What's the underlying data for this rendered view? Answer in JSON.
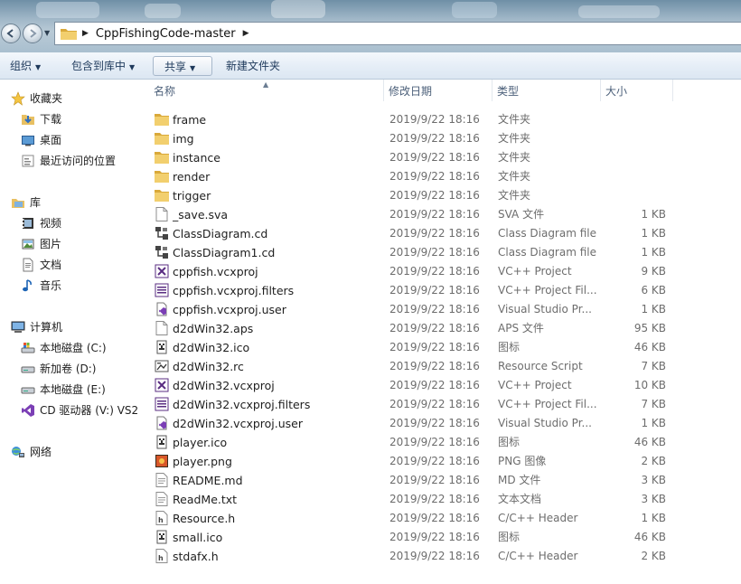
{
  "address": {
    "segments": [
      "CppFishingCode-master"
    ]
  },
  "toolbar": {
    "organize": "组织",
    "include_in_library": "包含到库中",
    "share": "共享",
    "new_folder": "新建文件夹"
  },
  "nav": {
    "favorites": {
      "label": "收藏夹",
      "items": [
        "下载",
        "桌面",
        "最近访问的位置"
      ]
    },
    "libraries": {
      "label": "库",
      "items": [
        "视频",
        "图片",
        "文档",
        "音乐"
      ]
    },
    "computer": {
      "label": "计算机",
      "items": [
        "本地磁盘 (C:)",
        "新加卷 (D:)",
        "本地磁盘 (E:)",
        "CD 驱动器 (V:) VS2"
      ]
    },
    "network": {
      "label": "网络"
    }
  },
  "columns": {
    "name": "名称",
    "modified": "修改日期",
    "type": "类型",
    "size": "大小"
  },
  "files": [
    {
      "icon": "folder-icon",
      "name": "frame",
      "date": "2019/9/22 18:16",
      "type": "文件夹",
      "size": ""
    },
    {
      "icon": "folder-icon",
      "name": "img",
      "date": "2019/9/22 18:16",
      "type": "文件夹",
      "size": ""
    },
    {
      "icon": "folder-icon",
      "name": "instance",
      "date": "2019/9/22 18:16",
      "type": "文件夹",
      "size": ""
    },
    {
      "icon": "folder-icon",
      "name": "render",
      "date": "2019/9/22 18:16",
      "type": "文件夹",
      "size": ""
    },
    {
      "icon": "folder-icon",
      "name": "trigger",
      "date": "2019/9/22 18:16",
      "type": "文件夹",
      "size": ""
    },
    {
      "icon": "blank-file-icon",
      "name": "_save.sva",
      "date": "2019/9/22 18:16",
      "type": "SVA 文件",
      "size": "1 KB"
    },
    {
      "icon": "class-diagram-icon",
      "name": "ClassDiagram.cd",
      "date": "2019/9/22 18:16",
      "type": "Class Diagram file",
      "size": "1 KB"
    },
    {
      "icon": "class-diagram-icon",
      "name": "ClassDiagram1.cd",
      "date": "2019/9/22 18:16",
      "type": "Class Diagram file",
      "size": "1 KB"
    },
    {
      "icon": "vcxproj-icon",
      "name": "cppfish.vcxproj",
      "date": "2019/9/22 18:16",
      "type": "VC++ Project",
      "size": "9 KB"
    },
    {
      "icon": "filters-icon",
      "name": "cppfish.vcxproj.filters",
      "date": "2019/9/22 18:16",
      "type": "VC++ Project Fil...",
      "size": "6 KB"
    },
    {
      "icon": "vs-user-icon",
      "name": "cppfish.vcxproj.user",
      "date": "2019/9/22 18:16",
      "type": "Visual Studio Pr...",
      "size": "1 KB"
    },
    {
      "icon": "blank-file-icon",
      "name": "d2dWin32.aps",
      "date": "2019/9/22 18:16",
      "type": "APS 文件",
      "size": "95 KB"
    },
    {
      "icon": "ico-file-icon",
      "name": "d2dWin32.ico",
      "date": "2019/9/22 18:16",
      "type": "图标",
      "size": "46 KB"
    },
    {
      "icon": "resource-script-icon",
      "name": "d2dWin32.rc",
      "date": "2019/9/22 18:16",
      "type": "Resource Script",
      "size": "7 KB"
    },
    {
      "icon": "vcxproj-icon",
      "name": "d2dWin32.vcxproj",
      "date": "2019/9/22 18:16",
      "type": "VC++ Project",
      "size": "10 KB"
    },
    {
      "icon": "filters-icon",
      "name": "d2dWin32.vcxproj.filters",
      "date": "2019/9/22 18:16",
      "type": "VC++ Project Fil...",
      "size": "7 KB"
    },
    {
      "icon": "vs-user-icon",
      "name": "d2dWin32.vcxproj.user",
      "date": "2019/9/22 18:16",
      "type": "Visual Studio Pr...",
      "size": "1 KB"
    },
    {
      "icon": "ico-file-icon",
      "name": "player.ico",
      "date": "2019/9/22 18:16",
      "type": "图标",
      "size": "46 KB"
    },
    {
      "icon": "png-file-icon",
      "name": "player.png",
      "date": "2019/9/22 18:16",
      "type": "PNG 图像",
      "size": "2 KB"
    },
    {
      "icon": "text-file-icon",
      "name": "README.md",
      "date": "2019/9/22 18:16",
      "type": "MD 文件",
      "size": "3 KB"
    },
    {
      "icon": "text-file-icon",
      "name": "ReadMe.txt",
      "date": "2019/9/22 18:16",
      "type": "文本文档",
      "size": "3 KB"
    },
    {
      "icon": "header-file-icon",
      "name": "Resource.h",
      "date": "2019/9/22 18:16",
      "type": "C/C++ Header",
      "size": "1 KB"
    },
    {
      "icon": "ico-file-icon",
      "name": "small.ico",
      "date": "2019/9/22 18:16",
      "type": "图标",
      "size": "46 KB"
    },
    {
      "icon": "header-file-icon",
      "name": "stdafx.h",
      "date": "2019/9/22 18:16",
      "type": "C/C++ Header",
      "size": "2 KB"
    }
  ],
  "colors": {
    "folder": "#e8c062",
    "toolbar_text": "#1e395b",
    "secondary_text": "#6d6d6d",
    "header_text": "#4c607a"
  }
}
